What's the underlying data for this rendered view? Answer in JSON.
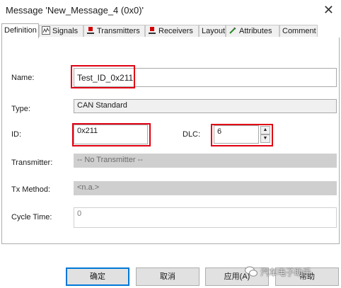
{
  "window": {
    "title": "Message 'New_Message_4 (0x0)'"
  },
  "tabs": [
    {
      "label": "Definition",
      "icon": "none"
    },
    {
      "label": "Signals",
      "icon": "signals-icon"
    },
    {
      "label": "Transmitters",
      "icon": "transmitter-icon"
    },
    {
      "label": "Receivers",
      "icon": "receiver-icon"
    },
    {
      "label": "Layout",
      "icon": "none"
    },
    {
      "label": "Attributes",
      "icon": "attributes-icon"
    },
    {
      "label": "Comment",
      "icon": "none"
    }
  ],
  "form": {
    "name_label": "Name:",
    "name_value": "Test_ID_0x211",
    "type_label": "Type:",
    "type_value": "CAN Standard",
    "id_label": "ID:",
    "id_value": "0x211",
    "dlc_label": "DLC:",
    "dlc_value": "6",
    "transmitter_label": "Transmitter:",
    "transmitter_value": "-- No Transmitter --",
    "txmethod_label": "Tx Method:",
    "txmethod_value": "<n.a.>",
    "cycle_label": "Cycle Time:",
    "cycle_value": "0"
  },
  "buttons": {
    "ok": "确定",
    "cancel": "取消",
    "apply": "应用(A)",
    "help": "帮助"
  },
  "watermark": {
    "text": "汽车电子助手"
  },
  "colors": {
    "highlight": "#e00012",
    "disabled": "#cfcfcf",
    "readonly": "#f0f0f0"
  }
}
